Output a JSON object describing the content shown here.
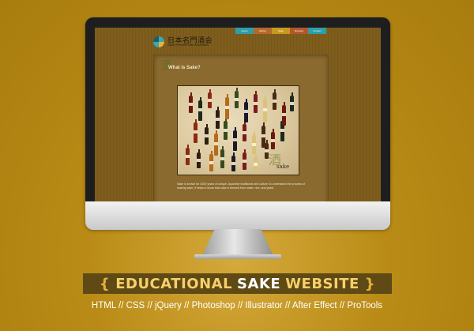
{
  "site": {
    "logo_title": "日本名門酒会",
    "logo_subtitle": "Japan Premium Sake Association",
    "nav": [
      {
        "label": "Home",
        "color": "#2f9ea8"
      },
      {
        "label": "History",
        "color": "#b8672a"
      },
      {
        "label": "Sake",
        "color": "#c79a1e"
      },
      {
        "label": "Brewing",
        "color": "#b4562d"
      },
      {
        "label": "Contact",
        "color": "#2f9ea8"
      }
    ],
    "panel_kanji": "酒",
    "panel_title": "What is Sake?",
    "photo_kanji": "酒",
    "photo_word": "sake",
    "panel_text": "Sake is known for 2000 years of unique Japanese traditional and culture.To understand the process of making sake, it helps to know that sake is brewed from water, rice, and yeast."
  },
  "banner": {
    "open": "{",
    "word1": "EDUCATIONAL",
    "word2": "SAKE",
    "word3": "WEBSITE",
    "close": "}"
  },
  "tech_line": "HTML // CSS // jQuery // Photoshop // Illustrator // After Effect // ProTools",
  "colors": {
    "background": "#b08512",
    "banner_bg": "#5f4a16",
    "banner_accent": "#f6d06a"
  }
}
